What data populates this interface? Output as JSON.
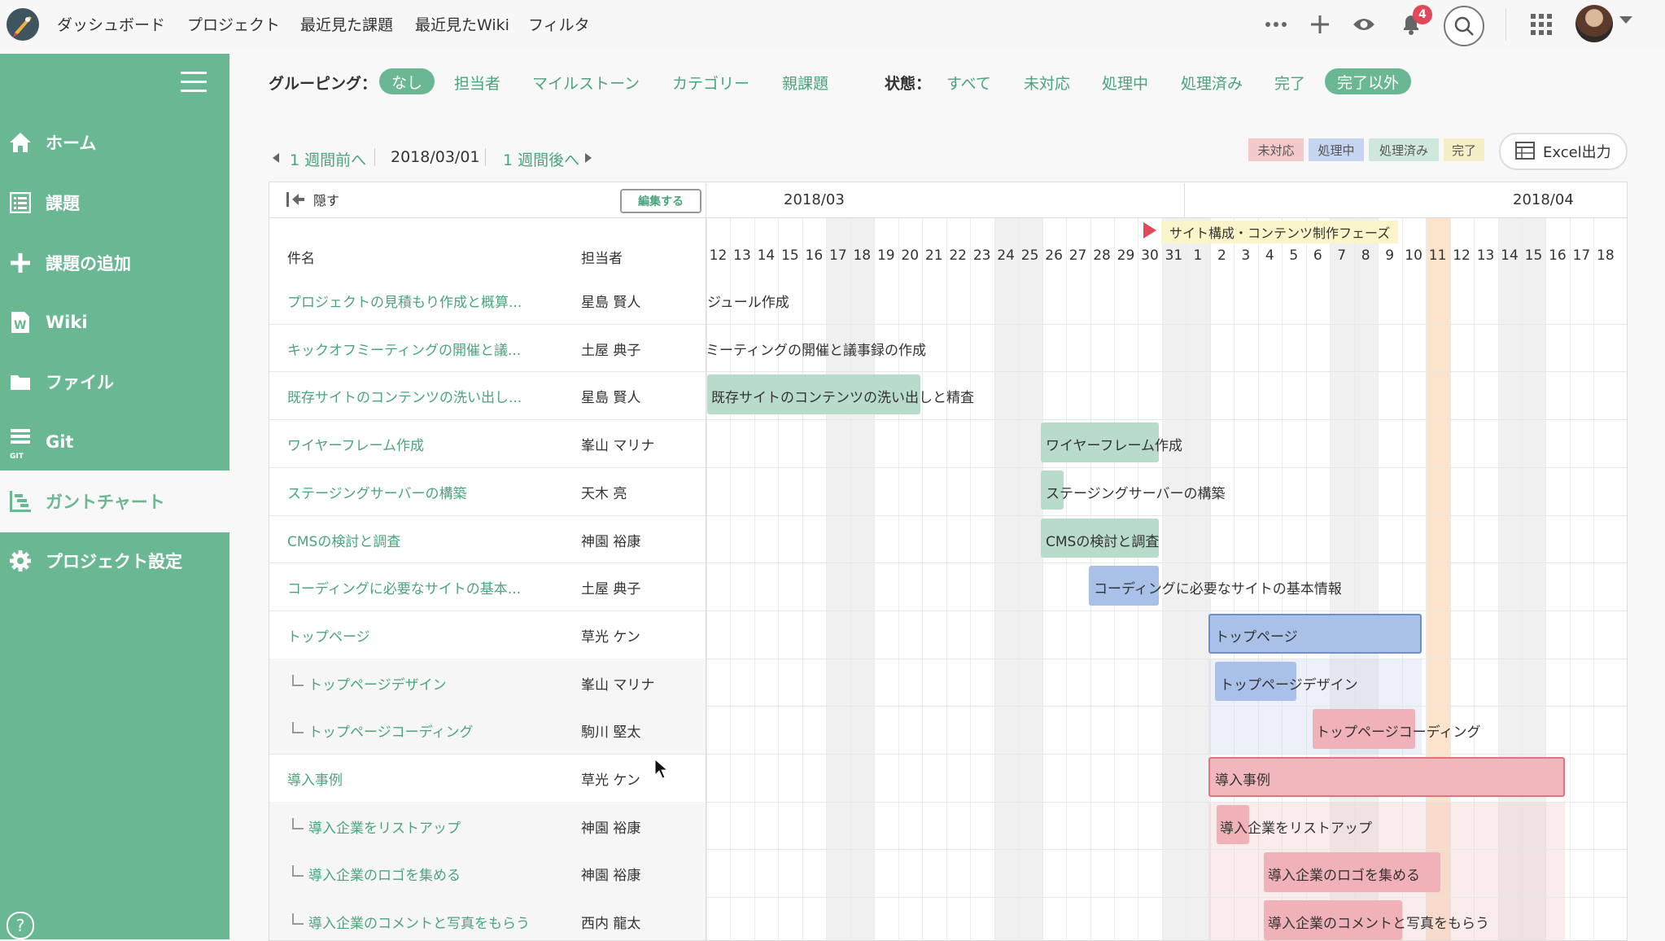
{
  "topnav": {
    "items": [
      "ダッシュボード",
      "プロジェクト",
      "最近見た課題",
      "最近見たWiki",
      "フィルタ"
    ],
    "notifications_count": "4",
    "icons": [
      "more-icon",
      "plus-icon",
      "eye-icon",
      "bell-icon",
      "search-icon",
      "apps-grid-icon"
    ]
  },
  "sidebar": {
    "items": [
      {
        "label": "ホーム",
        "icon": "home-icon"
      },
      {
        "label": "課題",
        "icon": "issues-list-icon"
      },
      {
        "label": "課題の追加",
        "icon": "plus-icon"
      },
      {
        "label": "Wiki",
        "icon": "wiki-icon"
      },
      {
        "label": "ファイル",
        "icon": "folder-icon"
      },
      {
        "label": "Git",
        "icon": "git-icon"
      },
      {
        "label": "ガントチャート",
        "icon": "gantt-icon",
        "active": true
      },
      {
        "label": "プロジェクト設定",
        "icon": "gear-icon"
      }
    ],
    "git_icon_text": "GIT",
    "help": "?"
  },
  "filters": {
    "grouping_label": "グルーピング：",
    "grouping_options": [
      "なし",
      "担当者",
      "マイルストーン",
      "カテゴリー",
      "親課題"
    ],
    "grouping_selected": "なし",
    "status_label": "状態：",
    "status_options": [
      "すべて",
      "未対応",
      "処理中",
      "処理済み",
      "完了",
      "完了以外"
    ],
    "status_selected": "完了以外"
  },
  "week_nav": {
    "prev": "1 週間前へ",
    "current": "2018/03/01",
    "next": "1 週間後へ"
  },
  "legend": [
    {
      "label": "未対応",
      "color": "#f4c9c9"
    },
    {
      "label": "処理中",
      "color": "#c5d5ef"
    },
    {
      "label": "処理済み",
      "color": "#cfe8dc"
    },
    {
      "label": "完了",
      "color": "#f4efc4"
    }
  ],
  "excel_button": "Excel出力",
  "gantt": {
    "hide_label": "隠す",
    "edit_label": "編集する",
    "months": [
      "2018/03",
      "2018/04"
    ],
    "columns": {
      "name": "件名",
      "assignee": "担当者"
    },
    "days": [
      "12",
      "13",
      "14",
      "15",
      "16",
      "17",
      "18",
      "19",
      "20",
      "21",
      "22",
      "23",
      "24",
      "25",
      "26",
      "27",
      "28",
      "29",
      "30",
      "31",
      "1",
      "2",
      "3",
      "4",
      "5",
      "6",
      "7",
      "8",
      "9",
      "10",
      "11",
      "12",
      "13",
      "14",
      "15",
      "16",
      "17",
      "18"
    ],
    "milestone": "サイト構成・コンテンツ制作フェーズ",
    "tasks": [
      {
        "name": "プロジェクトの見積もり作成と概算...",
        "assignee": "星島 賢人",
        "bar_label": "ジュール作成",
        "sub": false
      },
      {
        "name": "キックオフミーティングの開催と議...",
        "assignee": "土屋 典子",
        "bar_label": "ミーティングの開催と議事録の作成",
        "sub": false
      },
      {
        "name": "既存サイトのコンテンツの洗い出し...",
        "assignee": "星島 賢人",
        "bar_label": "既存サイトのコンテンツの洗い出しと精査",
        "sub": false
      },
      {
        "name": "ワイヤーフレーム作成",
        "assignee": "峯山 マリナ",
        "bar_label": "ワイヤーフレーム作成",
        "sub": false
      },
      {
        "name": "ステージングサーバーの構築",
        "assignee": "天木 亮",
        "bar_label": "ステージングサーバーの構築",
        "sub": false
      },
      {
        "name": "CMSの検討と調査",
        "assignee": "神園 裕康",
        "bar_label": "CMSの検討と調査",
        "sub": false
      },
      {
        "name": "コーディングに必要なサイトの基本...",
        "assignee": "土屋 典子",
        "bar_label": "コーディングに必要なサイトの基本情報",
        "sub": false
      },
      {
        "name": "トップページ",
        "assignee": "草光 ケン",
        "bar_label": "トップページ",
        "sub": false
      },
      {
        "name": "トップページデザイン",
        "assignee": "峯山 マリナ",
        "bar_label": "トップページデザイン",
        "sub": true
      },
      {
        "name": "トップページコーディング",
        "assignee": "駒川 堅太",
        "bar_label": "トップページコーディング",
        "sub": true
      },
      {
        "name": "導入事例",
        "assignee": "草光 ケン",
        "bar_label": "導入事例",
        "sub": false
      },
      {
        "name": "導入企業をリストアップ",
        "assignee": "神園 裕康",
        "bar_label": "導入企業をリストアップ",
        "sub": true
      },
      {
        "name": "導入企業のロゴを集める",
        "assignee": "神園 裕康",
        "bar_label": "導入企業のロゴを集める",
        "sub": true
      },
      {
        "name": "導入企業のコメントと写真をもらう",
        "assignee": "西内 龍太",
        "bar_label": "導入企業のコメントと写真をもらう",
        "sub": true
      }
    ]
  },
  "colors": {
    "sidebar_green": "#6ab793",
    "link_green": "#4aa47c",
    "done_bar": "#cfe8dc",
    "progress_bar": "#c5d5ef",
    "open_bar": "#f4c9c9",
    "weekend": "#f0f0f0",
    "today": "#fbe3cc"
  }
}
